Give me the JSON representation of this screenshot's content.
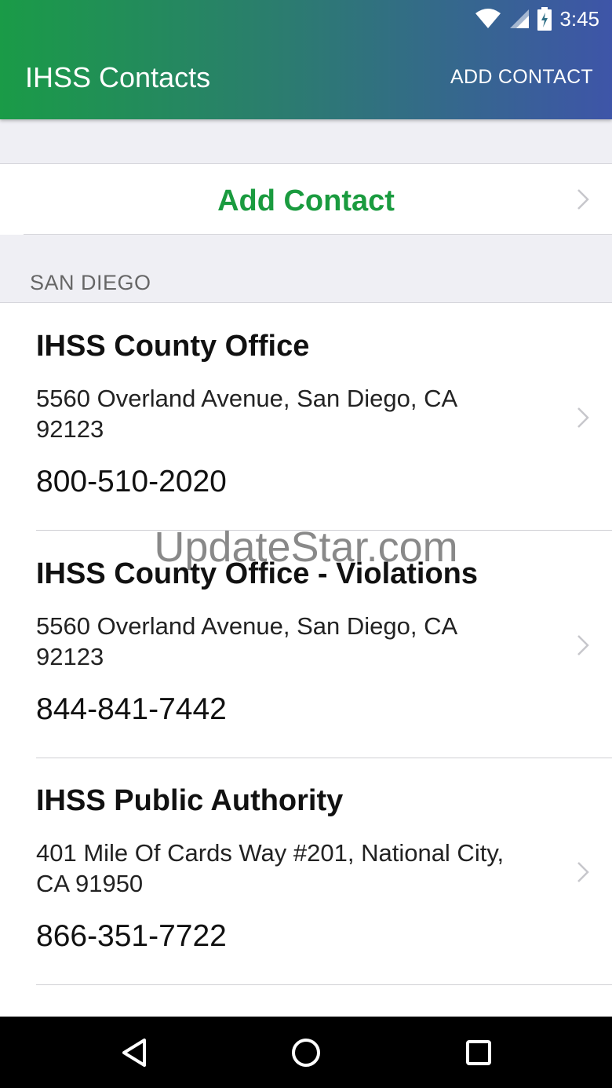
{
  "status_bar": {
    "time": "3:45"
  },
  "app_bar": {
    "title": "IHSS Contacts",
    "action_label": "ADD CONTACT"
  },
  "add_contact_row": {
    "label": "Add Contact"
  },
  "section": {
    "header": "SAN DIEGO"
  },
  "contacts": [
    {
      "name": "IHSS County Office",
      "address": "5560 Overland Avenue, San Diego, CA 92123",
      "phone": "800-510-2020"
    },
    {
      "name": "IHSS County Office - Violations",
      "address": "5560 Overland Avenue, San Diego, CA 92123",
      "phone": "844-841-7442"
    },
    {
      "name": "IHSS Public Authority",
      "address": "401 Mile Of Cards Way #201, National City, CA 91950",
      "phone": "866-351-7722"
    }
  ],
  "watermark": "UpdateStar.com",
  "colors": {
    "accent_green": "#1a9b3f",
    "bar_start": "#1a9b47",
    "bar_end": "#3e55a8"
  },
  "icons": [
    "wifi-icon",
    "cell-signal-icon",
    "battery-charging-icon",
    "chevron-right-icon",
    "back-icon",
    "home-icon",
    "recents-icon"
  ]
}
